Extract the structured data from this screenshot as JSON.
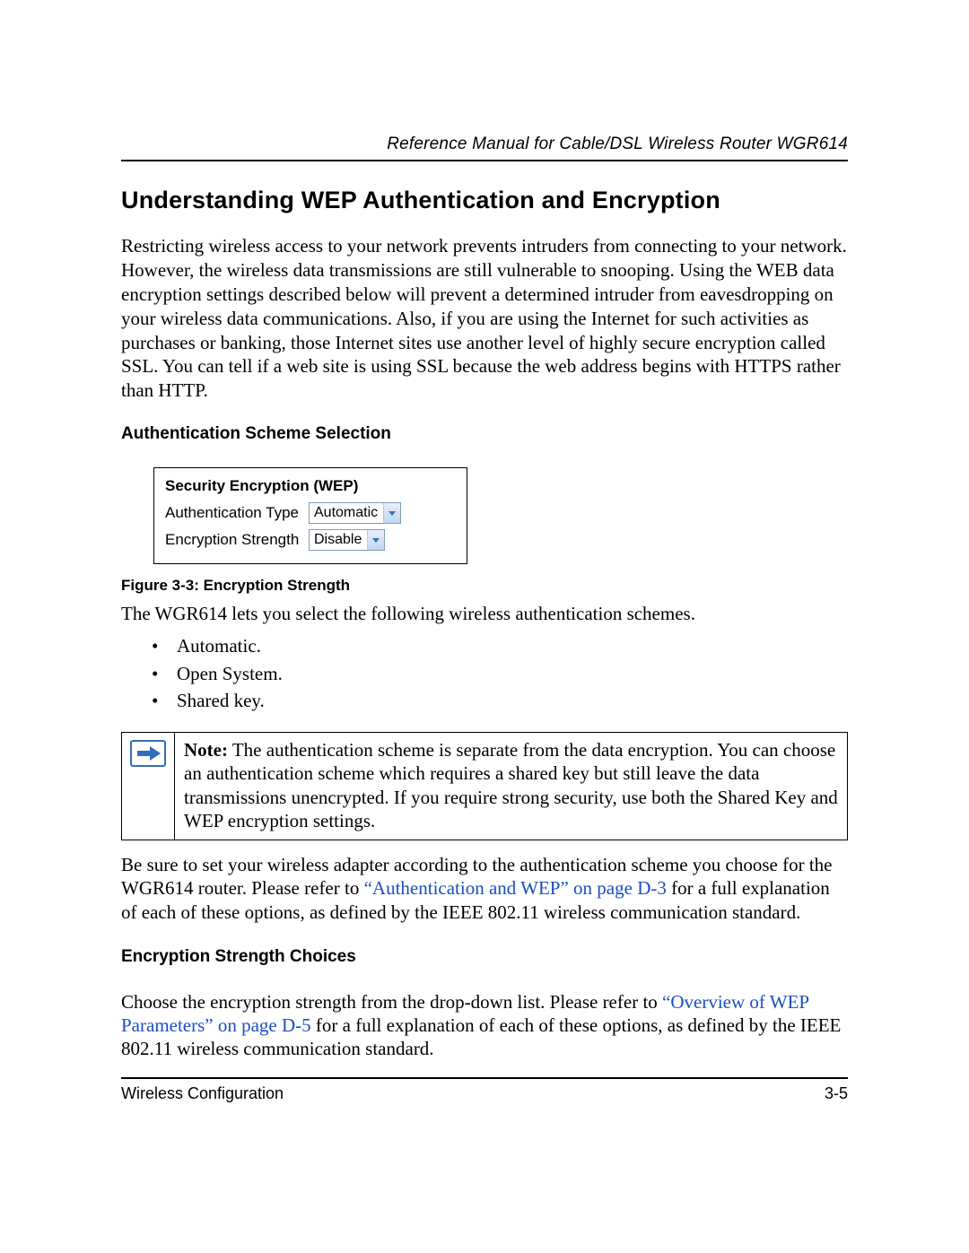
{
  "header": {
    "running_title": "Reference Manual for Cable/DSL Wireless Router WGR614"
  },
  "section": {
    "title": "Understanding WEP Authentication and Encryption",
    "intro": "Restricting wireless access to your network prevents intruders from connecting to your network. However, the wireless data transmissions are still vulnerable to snooping. Using the WEB data encryption settings described below will prevent a determined intruder from eavesdropping on your wireless data communications. Also, if you are using the Internet for such activities as purchases or banking, those Internet sites use another level of highly secure encryption called SSL. You can tell if a web site is using SSL because the web address begins with HTTPS rather than HTTP."
  },
  "sub1": {
    "title": "Authentication Scheme Selection",
    "figure": {
      "panel_title": "Security Encryption (WEP)",
      "row1_label": "Authentication Type",
      "row1_value": "Automatic",
      "row2_label": "Encryption Strength",
      "row2_value": "Disable",
      "caption": "Figure 3-3:  Encryption Strength"
    },
    "lead": "The WGR614 lets you select the following wireless authentication schemes.",
    "bullets": [
      "Automatic.",
      "Open System.",
      "Shared key."
    ],
    "note_label": "Note:",
    "note_body": " The authentication scheme is separate from the data encryption. You can choose an authentication scheme which requires a shared key but still leave the data transmissions unencrypted. If you require strong security, use both the Shared Key and WEP encryption settings.",
    "after_note_1": "Be sure to set your wireless adapter according to the authentication scheme you choose for the WGR614 router. Please refer to ",
    "after_note_link": "“Authentication and WEP” on page D-3",
    "after_note_2": " for a full explanation of each of these options, as defined by the IEEE 802.11 wireless communication standard."
  },
  "sub2": {
    "title": "Encryption Strength Choices",
    "p_1": "Choose the encryption strength from the drop-down list. Please refer to ",
    "p_link": "“Overview of WEP Parameters” on page D-5",
    "p_2": " for a full explanation of each of these options, as defined by the IEEE 802.11 wireless communication standard."
  },
  "footer": {
    "left": "Wireless Configuration",
    "right": "3-5"
  }
}
